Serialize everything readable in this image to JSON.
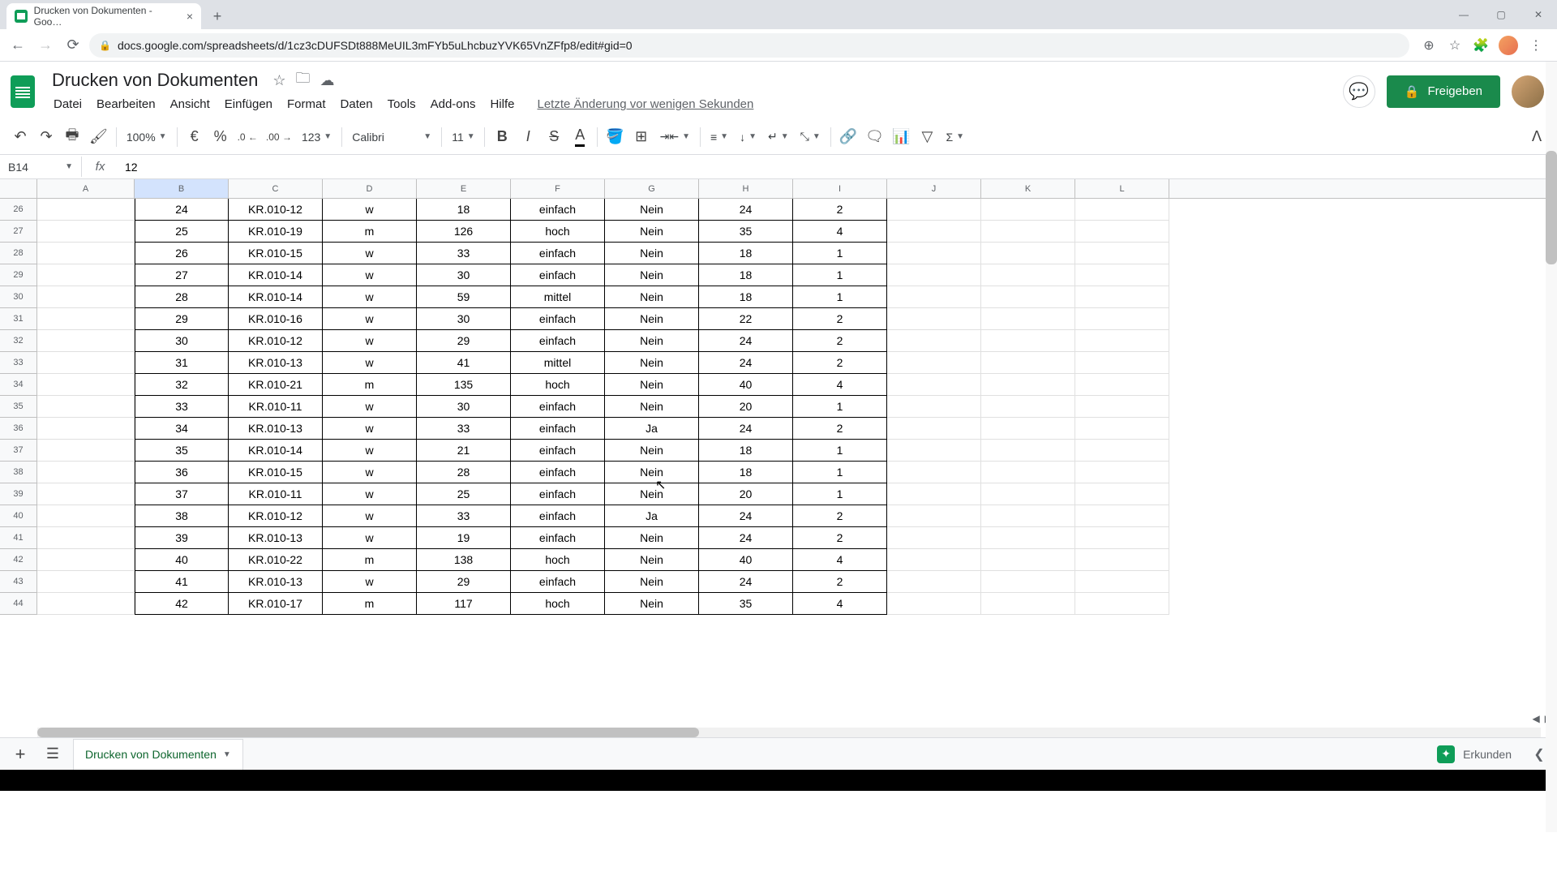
{
  "browser": {
    "tab_title": "Drucken von Dokumenten - Goo…",
    "url": "docs.google.com/spreadsheets/d/1cz3cDUFSDt888MeUIL3mFYb5uLhcbuzYVK65VnZFfp8/edit#gid=0"
  },
  "doc": {
    "title": "Drucken von Dokumenten",
    "last_edit": "Letzte Änderung vor wenigen Sekunden"
  },
  "menus": [
    "Datei",
    "Bearbeiten",
    "Ansicht",
    "Einfügen",
    "Format",
    "Daten",
    "Tools",
    "Add-ons",
    "Hilfe"
  ],
  "share_label": "Freigeben",
  "toolbar": {
    "zoom": "100%",
    "currency": "€",
    "percent": "%",
    "dec_dec": ".0",
    "inc_dec": ".00",
    "format123": "123",
    "font": "Calibri",
    "font_size": "11"
  },
  "cell_ref": "B14",
  "formula": "12",
  "columns": [
    "A",
    "B",
    "C",
    "D",
    "E",
    "F",
    "G",
    "H",
    "I",
    "J",
    "K",
    "L"
  ],
  "rows": [
    {
      "n": "26",
      "B": "24",
      "C": "KR.010-12",
      "D": "w",
      "E": "18",
      "F": "einfach",
      "G": "Nein",
      "H": "24",
      "I": "2"
    },
    {
      "n": "27",
      "B": "25",
      "C": "KR.010-19",
      "D": "m",
      "E": "126",
      "F": "hoch",
      "G": "Nein",
      "H": "35",
      "I": "4"
    },
    {
      "n": "28",
      "B": "26",
      "C": "KR.010-15",
      "D": "w",
      "E": "33",
      "F": "einfach",
      "G": "Nein",
      "H": "18",
      "I": "1"
    },
    {
      "n": "29",
      "B": "27",
      "C": "KR.010-14",
      "D": "w",
      "E": "30",
      "F": "einfach",
      "G": "Nein",
      "H": "18",
      "I": "1"
    },
    {
      "n": "30",
      "B": "28",
      "C": "KR.010-14",
      "D": "w",
      "E": "59",
      "F": "mittel",
      "G": "Nein",
      "H": "18",
      "I": "1"
    },
    {
      "n": "31",
      "B": "29",
      "C": "KR.010-16",
      "D": "w",
      "E": "30",
      "F": "einfach",
      "G": "Nein",
      "H": "22",
      "I": "2"
    },
    {
      "n": "32",
      "B": "30",
      "C": "KR.010-12",
      "D": "w",
      "E": "29",
      "F": "einfach",
      "G": "Nein",
      "H": "24",
      "I": "2"
    },
    {
      "n": "33",
      "B": "31",
      "C": "KR.010-13",
      "D": "w",
      "E": "41",
      "F": "mittel",
      "G": "Nein",
      "H": "24",
      "I": "2"
    },
    {
      "n": "34",
      "B": "32",
      "C": "KR.010-21",
      "D": "m",
      "E": "135",
      "F": "hoch",
      "G": "Nein",
      "H": "40",
      "I": "4"
    },
    {
      "n": "35",
      "B": "33",
      "C": "KR.010-11",
      "D": "w",
      "E": "30",
      "F": "einfach",
      "G": "Nein",
      "H": "20",
      "I": "1"
    },
    {
      "n": "36",
      "B": "34",
      "C": "KR.010-13",
      "D": "w",
      "E": "33",
      "F": "einfach",
      "G": "Ja",
      "H": "24",
      "I": "2"
    },
    {
      "n": "37",
      "B": "35",
      "C": "KR.010-14",
      "D": "w",
      "E": "21",
      "F": "einfach",
      "G": "Nein",
      "H": "18",
      "I": "1"
    },
    {
      "n": "38",
      "B": "36",
      "C": "KR.010-15",
      "D": "w",
      "E": "28",
      "F": "einfach",
      "G": "Nein",
      "H": "18",
      "I": "1"
    },
    {
      "n": "39",
      "B": "37",
      "C": "KR.010-11",
      "D": "w",
      "E": "25",
      "F": "einfach",
      "G": "Nein",
      "H": "20",
      "I": "1"
    },
    {
      "n": "40",
      "B": "38",
      "C": "KR.010-12",
      "D": "w",
      "E": "33",
      "F": "einfach",
      "G": "Ja",
      "H": "24",
      "I": "2"
    },
    {
      "n": "41",
      "B": "39",
      "C": "KR.010-13",
      "D": "w",
      "E": "19",
      "F": "einfach",
      "G": "Nein",
      "H": "24",
      "I": "2"
    },
    {
      "n": "42",
      "B": "40",
      "C": "KR.010-22",
      "D": "m",
      "E": "138",
      "F": "hoch",
      "G": "Nein",
      "H": "40",
      "I": "4"
    },
    {
      "n": "43",
      "B": "41",
      "C": "KR.010-13",
      "D": "w",
      "E": "29",
      "F": "einfach",
      "G": "Nein",
      "H": "24",
      "I": "2"
    },
    {
      "n": "44",
      "B": "42",
      "C": "KR.010-17",
      "D": "m",
      "E": "117",
      "F": "hoch",
      "G": "Nein",
      "H": "35",
      "I": "4"
    }
  ],
  "sheet_tab": "Drucken von Dokumenten",
  "explore_label": "Erkunden"
}
